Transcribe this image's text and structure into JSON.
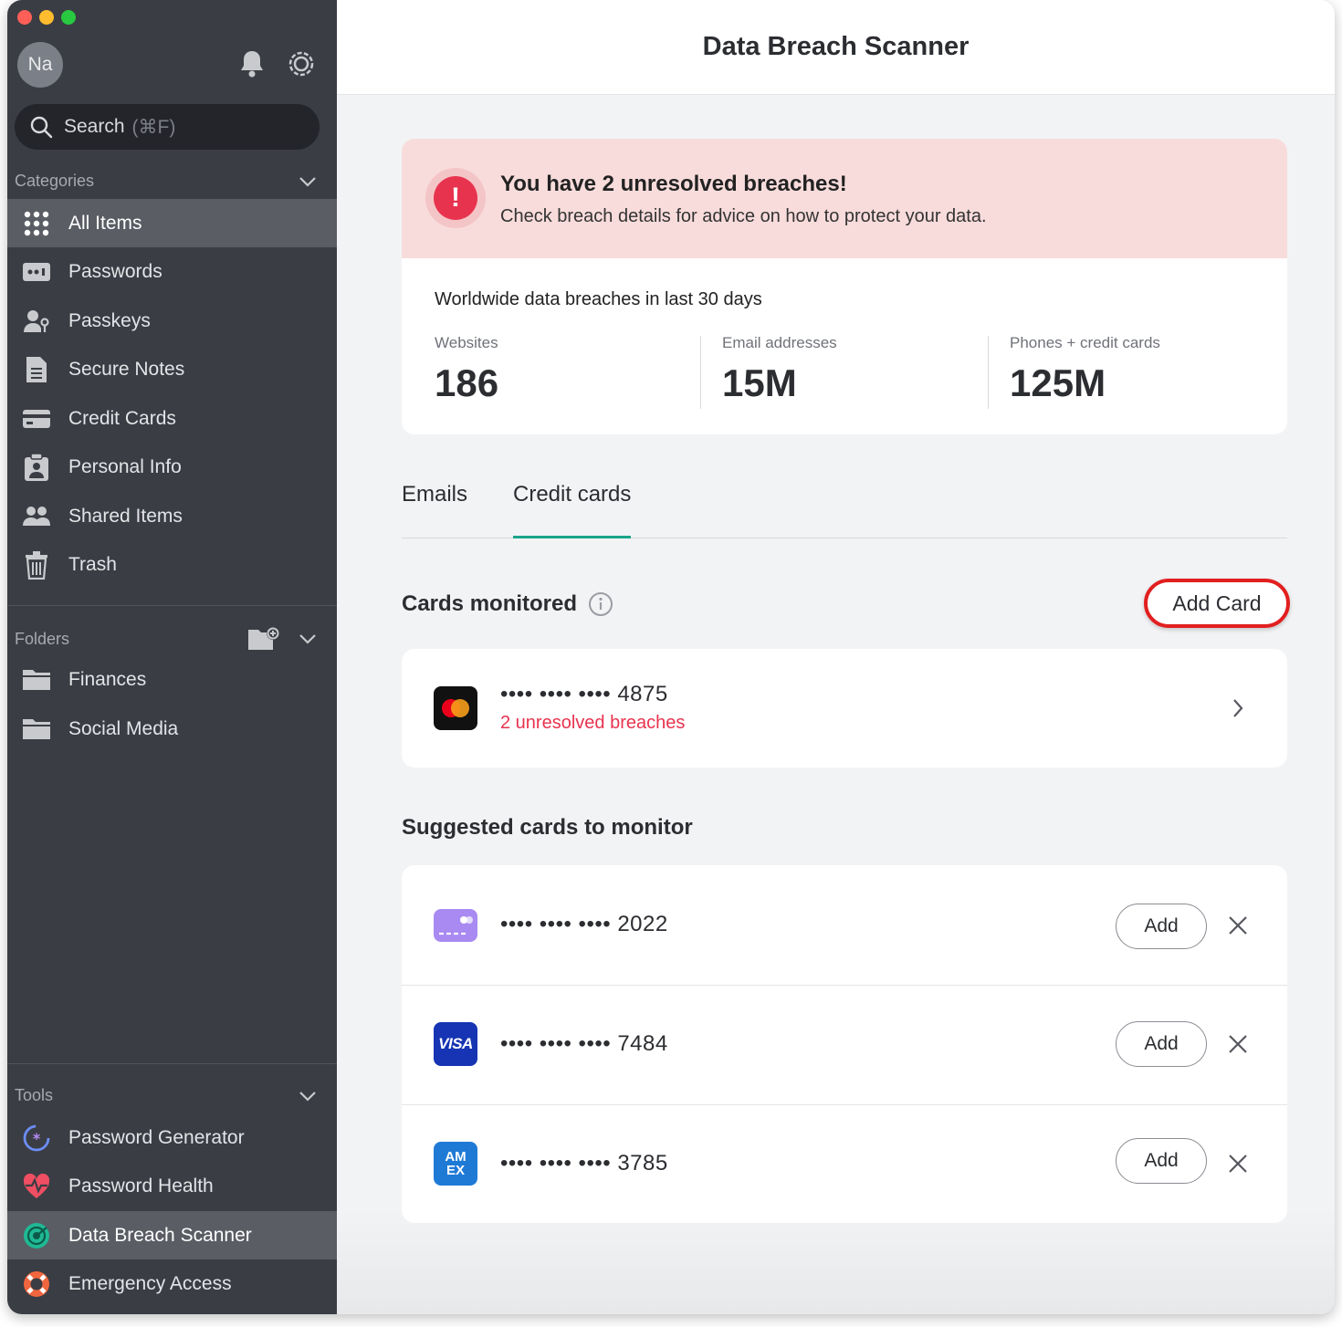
{
  "window": {
    "traffic_colors": [
      "#ff5f57",
      "#febc2e",
      "#28c840"
    ]
  },
  "sidebar": {
    "avatar_initials": "Na",
    "search": {
      "label": "Search",
      "shortcut": "(⌘F)"
    },
    "categories_label": "Categories",
    "categories": [
      {
        "label": "All Items",
        "icon": "grid-icon",
        "active": true
      },
      {
        "label": "Passwords",
        "icon": "password-icon"
      },
      {
        "label": "Passkeys",
        "icon": "passkey-icon"
      },
      {
        "label": "Secure Notes",
        "icon": "note-icon"
      },
      {
        "label": "Credit Cards",
        "icon": "credit-card-icon"
      },
      {
        "label": "Personal Info",
        "icon": "id-badge-icon"
      },
      {
        "label": "Shared Items",
        "icon": "people-icon"
      },
      {
        "label": "Trash",
        "icon": "trash-icon"
      }
    ],
    "folders_label": "Folders",
    "folders": [
      {
        "label": "Finances",
        "icon": "folder-icon"
      },
      {
        "label": "Social Media",
        "icon": "folder-icon"
      }
    ],
    "tools_label": "Tools",
    "tools": [
      {
        "label": "Password Generator",
        "icon": "generator-icon"
      },
      {
        "label": "Password Health",
        "icon": "heart-pulse-icon"
      },
      {
        "label": "Data Breach Scanner",
        "icon": "radar-icon",
        "active": true
      },
      {
        "label": "Emergency Access",
        "icon": "lifebuoy-icon"
      }
    ]
  },
  "main": {
    "title": "Data Breach Scanner",
    "alert": {
      "title": "You have 2 unresolved breaches!",
      "subtitle": "Check breach details for advice on how to protect your data."
    },
    "stats": {
      "title": "Worldwide data breaches in last 30 days",
      "items": [
        {
          "label": "Websites",
          "value": "186"
        },
        {
          "label": "Email addresses",
          "value": "15M"
        },
        {
          "label": "Phones + credit cards",
          "value": "125M"
        }
      ]
    },
    "tabs": [
      {
        "label": "Emails",
        "active": false
      },
      {
        "label": "Credit cards",
        "active": true
      }
    ],
    "monitored": {
      "title": "Cards monitored",
      "add_card_label": "Add Card",
      "cards": [
        {
          "number": "•••• •••• •••• 4875",
          "brand": "mastercard",
          "status": "2 unresolved breaches"
        }
      ]
    },
    "suggested": {
      "title": "Suggested cards to monitor",
      "add_label": "Add",
      "cards": [
        {
          "number": "•••• •••• •••• 2022",
          "brand": "generic"
        },
        {
          "number": "•••• •••• •••• 7484",
          "brand": "visa",
          "logo_text": "VISA"
        },
        {
          "number": "•••• •••• •••• 3785",
          "brand": "amex",
          "logo_text": "AM EX"
        }
      ]
    }
  }
}
